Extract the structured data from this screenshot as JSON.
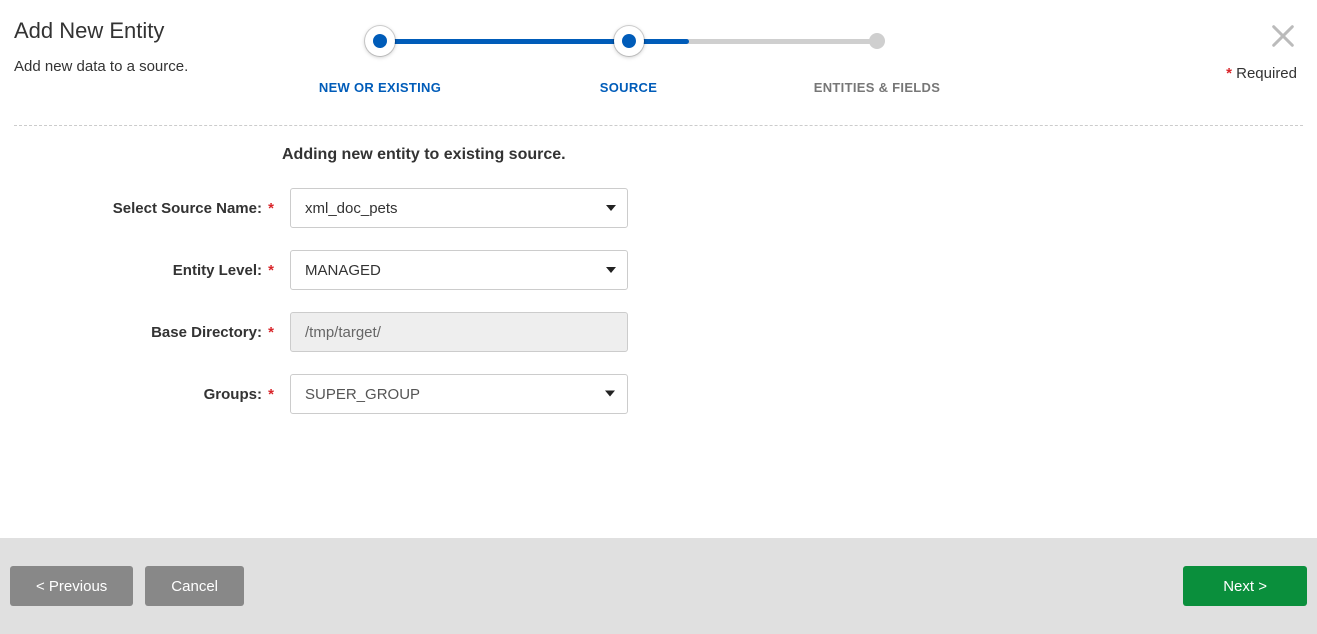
{
  "header": {
    "title": "Add New Entity",
    "subtitle": "Add new data to a source.",
    "required_label": "Required"
  },
  "stepper": {
    "steps": [
      {
        "label": "NEW OR EXISTING",
        "state": "complete"
      },
      {
        "label": "SOURCE",
        "state": "current"
      },
      {
        "label": "ENTITIES & FIELDS",
        "state": "upcoming"
      }
    ]
  },
  "form": {
    "heading": "Adding new entity to existing source.",
    "source_name": {
      "label": "Select Source Name:",
      "value": "xml_doc_pets"
    },
    "entity_level": {
      "label": "Entity Level:",
      "value": "MANAGED"
    },
    "base_directory": {
      "label": "Base Directory:",
      "value": "/tmp/target/"
    },
    "groups": {
      "label": "Groups:",
      "value": "SUPER_GROUP"
    }
  },
  "footer": {
    "previous": "< Previous",
    "cancel": "Cancel",
    "next": "Next >"
  }
}
